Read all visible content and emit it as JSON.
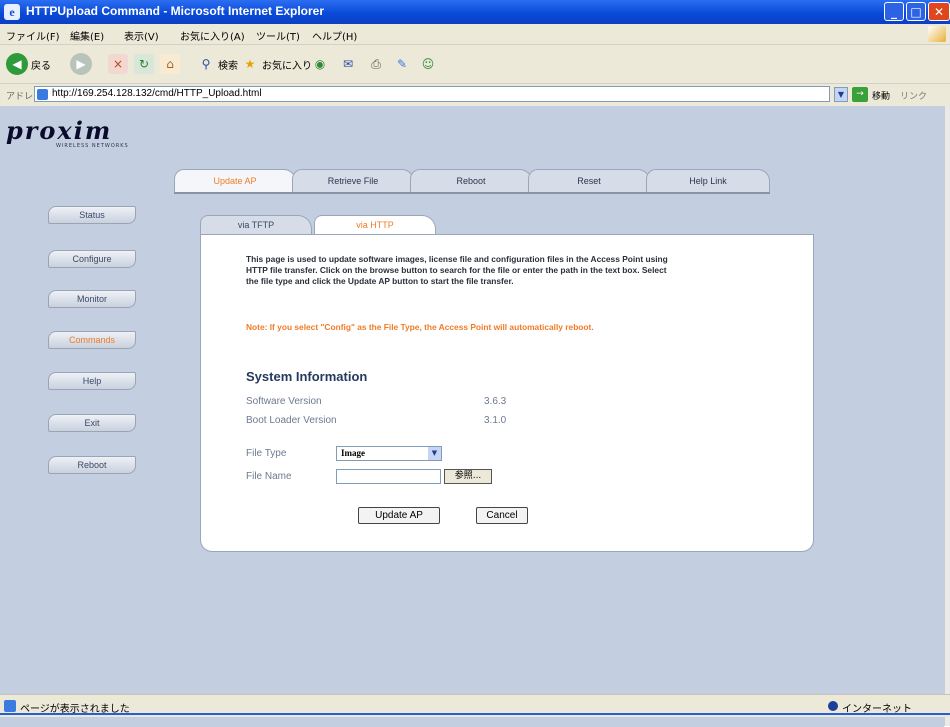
{
  "window": {
    "title": "HTTPUpload Command - Microsoft Internet Explorer",
    "ie_glyph": "e",
    "min": "_",
    "max": "□",
    "close": "✕"
  },
  "menubar": {
    "items": [
      "ファイル(F)",
      "編集(E)",
      "表示(V)",
      "お気に入り(A)",
      "ツール(T)",
      "ヘルプ(H)"
    ]
  },
  "toolbar": {
    "back_label": "戻る",
    "search_label": "検索",
    "favorites_label": "お気に入り",
    "icons": {
      "back": "◀",
      "forward": "▶",
      "stop": "×",
      "refresh": "↻",
      "home": "⌂",
      "search": "⚲",
      "favorites": "★",
      "media": "◉",
      "mail": "✉",
      "print": "⎙",
      "edit": "✎",
      "messenger": "☺"
    }
  },
  "addressbar": {
    "label": "アドレス(D)",
    "url": "http://169.254.128.132/cmd/HTTP_Upload.html",
    "dropdown": "▼",
    "go_icon": "→",
    "go_label": "移動",
    "links_label": "リンク"
  },
  "logo": {
    "text": "proxim",
    "subtitle": "WIRELESS NETWORKS"
  },
  "top_tabs": [
    {
      "label": "Update AP",
      "active": true
    },
    {
      "label": "Retrieve File",
      "active": false
    },
    {
      "label": "Reboot",
      "active": false
    },
    {
      "label": "Reset",
      "active": false
    },
    {
      "label": "Help Link",
      "active": false
    }
  ],
  "side_buttons": [
    {
      "label": "Status",
      "active": false
    },
    {
      "label": "Configure",
      "active": false
    },
    {
      "label": "Monitor",
      "active": false
    },
    {
      "label": "Commands",
      "active": true
    },
    {
      "label": "Help",
      "active": false
    },
    {
      "label": "Exit",
      "active": false
    },
    {
      "label": "Reboot",
      "active": false
    }
  ],
  "sub_tabs": {
    "tftp": "via TFTP",
    "http": "via HTTP"
  },
  "content": {
    "description": "This page is used to update software images, license file and configuration files in the Access Point using HTTP file transfer. Click on the browse button to search for the file or enter the path in the text box. Select the file type and click the Update AP button to start the file transfer.",
    "note": "Note: If you select \"Config\" as the File Type, the Access Point will automatically reboot.",
    "system_info_title": "System Information",
    "software_version_label": "Software Version",
    "software_version": "3.6.3",
    "bootloader_label": "Boot Loader Version",
    "bootloader_version": "3.1.0",
    "file_type_label": "File Type",
    "file_type_value": "Image",
    "file_type_dropdown": "▼",
    "file_name_label": "File Name",
    "file_name_value": "",
    "browse_label": "参照...",
    "update_button": "Update AP",
    "cancel_button": "Cancel"
  },
  "statusbar": {
    "text": "ページが表示されました",
    "zone": "インターネット"
  }
}
